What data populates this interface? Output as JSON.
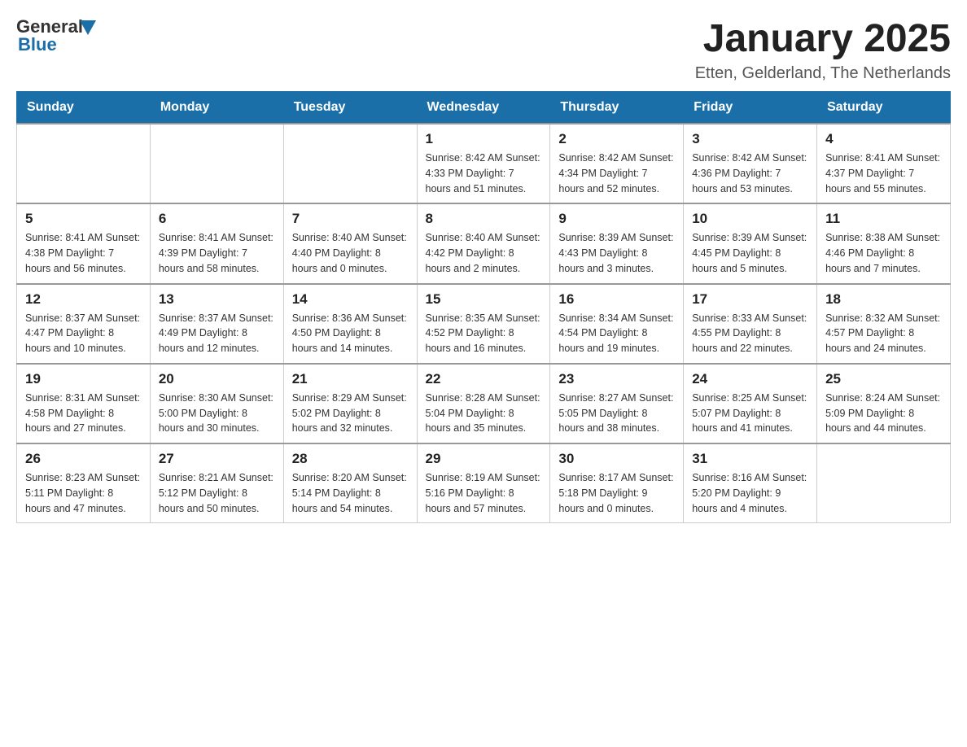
{
  "logo": {
    "text_general": "General",
    "text_blue": "Blue"
  },
  "title": {
    "month_year": "January 2025",
    "location": "Etten, Gelderland, The Netherlands"
  },
  "weekdays": [
    "Sunday",
    "Monday",
    "Tuesday",
    "Wednesday",
    "Thursday",
    "Friday",
    "Saturday"
  ],
  "weeks": [
    [
      {
        "day": "",
        "info": ""
      },
      {
        "day": "",
        "info": ""
      },
      {
        "day": "",
        "info": ""
      },
      {
        "day": "1",
        "info": "Sunrise: 8:42 AM\nSunset: 4:33 PM\nDaylight: 7 hours\nand 51 minutes."
      },
      {
        "day": "2",
        "info": "Sunrise: 8:42 AM\nSunset: 4:34 PM\nDaylight: 7 hours\nand 52 minutes."
      },
      {
        "day": "3",
        "info": "Sunrise: 8:42 AM\nSunset: 4:36 PM\nDaylight: 7 hours\nand 53 minutes."
      },
      {
        "day": "4",
        "info": "Sunrise: 8:41 AM\nSunset: 4:37 PM\nDaylight: 7 hours\nand 55 minutes."
      }
    ],
    [
      {
        "day": "5",
        "info": "Sunrise: 8:41 AM\nSunset: 4:38 PM\nDaylight: 7 hours\nand 56 minutes."
      },
      {
        "day": "6",
        "info": "Sunrise: 8:41 AM\nSunset: 4:39 PM\nDaylight: 7 hours\nand 58 minutes."
      },
      {
        "day": "7",
        "info": "Sunrise: 8:40 AM\nSunset: 4:40 PM\nDaylight: 8 hours\nand 0 minutes."
      },
      {
        "day": "8",
        "info": "Sunrise: 8:40 AM\nSunset: 4:42 PM\nDaylight: 8 hours\nand 2 minutes."
      },
      {
        "day": "9",
        "info": "Sunrise: 8:39 AM\nSunset: 4:43 PM\nDaylight: 8 hours\nand 3 minutes."
      },
      {
        "day": "10",
        "info": "Sunrise: 8:39 AM\nSunset: 4:45 PM\nDaylight: 8 hours\nand 5 minutes."
      },
      {
        "day": "11",
        "info": "Sunrise: 8:38 AM\nSunset: 4:46 PM\nDaylight: 8 hours\nand 7 minutes."
      }
    ],
    [
      {
        "day": "12",
        "info": "Sunrise: 8:37 AM\nSunset: 4:47 PM\nDaylight: 8 hours\nand 10 minutes."
      },
      {
        "day": "13",
        "info": "Sunrise: 8:37 AM\nSunset: 4:49 PM\nDaylight: 8 hours\nand 12 minutes."
      },
      {
        "day": "14",
        "info": "Sunrise: 8:36 AM\nSunset: 4:50 PM\nDaylight: 8 hours\nand 14 minutes."
      },
      {
        "day": "15",
        "info": "Sunrise: 8:35 AM\nSunset: 4:52 PM\nDaylight: 8 hours\nand 16 minutes."
      },
      {
        "day": "16",
        "info": "Sunrise: 8:34 AM\nSunset: 4:54 PM\nDaylight: 8 hours\nand 19 minutes."
      },
      {
        "day": "17",
        "info": "Sunrise: 8:33 AM\nSunset: 4:55 PM\nDaylight: 8 hours\nand 22 minutes."
      },
      {
        "day": "18",
        "info": "Sunrise: 8:32 AM\nSunset: 4:57 PM\nDaylight: 8 hours\nand 24 minutes."
      }
    ],
    [
      {
        "day": "19",
        "info": "Sunrise: 8:31 AM\nSunset: 4:58 PM\nDaylight: 8 hours\nand 27 minutes."
      },
      {
        "day": "20",
        "info": "Sunrise: 8:30 AM\nSunset: 5:00 PM\nDaylight: 8 hours\nand 30 minutes."
      },
      {
        "day": "21",
        "info": "Sunrise: 8:29 AM\nSunset: 5:02 PM\nDaylight: 8 hours\nand 32 minutes."
      },
      {
        "day": "22",
        "info": "Sunrise: 8:28 AM\nSunset: 5:04 PM\nDaylight: 8 hours\nand 35 minutes."
      },
      {
        "day": "23",
        "info": "Sunrise: 8:27 AM\nSunset: 5:05 PM\nDaylight: 8 hours\nand 38 minutes."
      },
      {
        "day": "24",
        "info": "Sunrise: 8:25 AM\nSunset: 5:07 PM\nDaylight: 8 hours\nand 41 minutes."
      },
      {
        "day": "25",
        "info": "Sunrise: 8:24 AM\nSunset: 5:09 PM\nDaylight: 8 hours\nand 44 minutes."
      }
    ],
    [
      {
        "day": "26",
        "info": "Sunrise: 8:23 AM\nSunset: 5:11 PM\nDaylight: 8 hours\nand 47 minutes."
      },
      {
        "day": "27",
        "info": "Sunrise: 8:21 AM\nSunset: 5:12 PM\nDaylight: 8 hours\nand 50 minutes."
      },
      {
        "day": "28",
        "info": "Sunrise: 8:20 AM\nSunset: 5:14 PM\nDaylight: 8 hours\nand 54 minutes."
      },
      {
        "day": "29",
        "info": "Sunrise: 8:19 AM\nSunset: 5:16 PM\nDaylight: 8 hours\nand 57 minutes."
      },
      {
        "day": "30",
        "info": "Sunrise: 8:17 AM\nSunset: 5:18 PM\nDaylight: 9 hours\nand 0 minutes."
      },
      {
        "day": "31",
        "info": "Sunrise: 8:16 AM\nSunset: 5:20 PM\nDaylight: 9 hours\nand 4 minutes."
      },
      {
        "day": "",
        "info": ""
      }
    ]
  ]
}
